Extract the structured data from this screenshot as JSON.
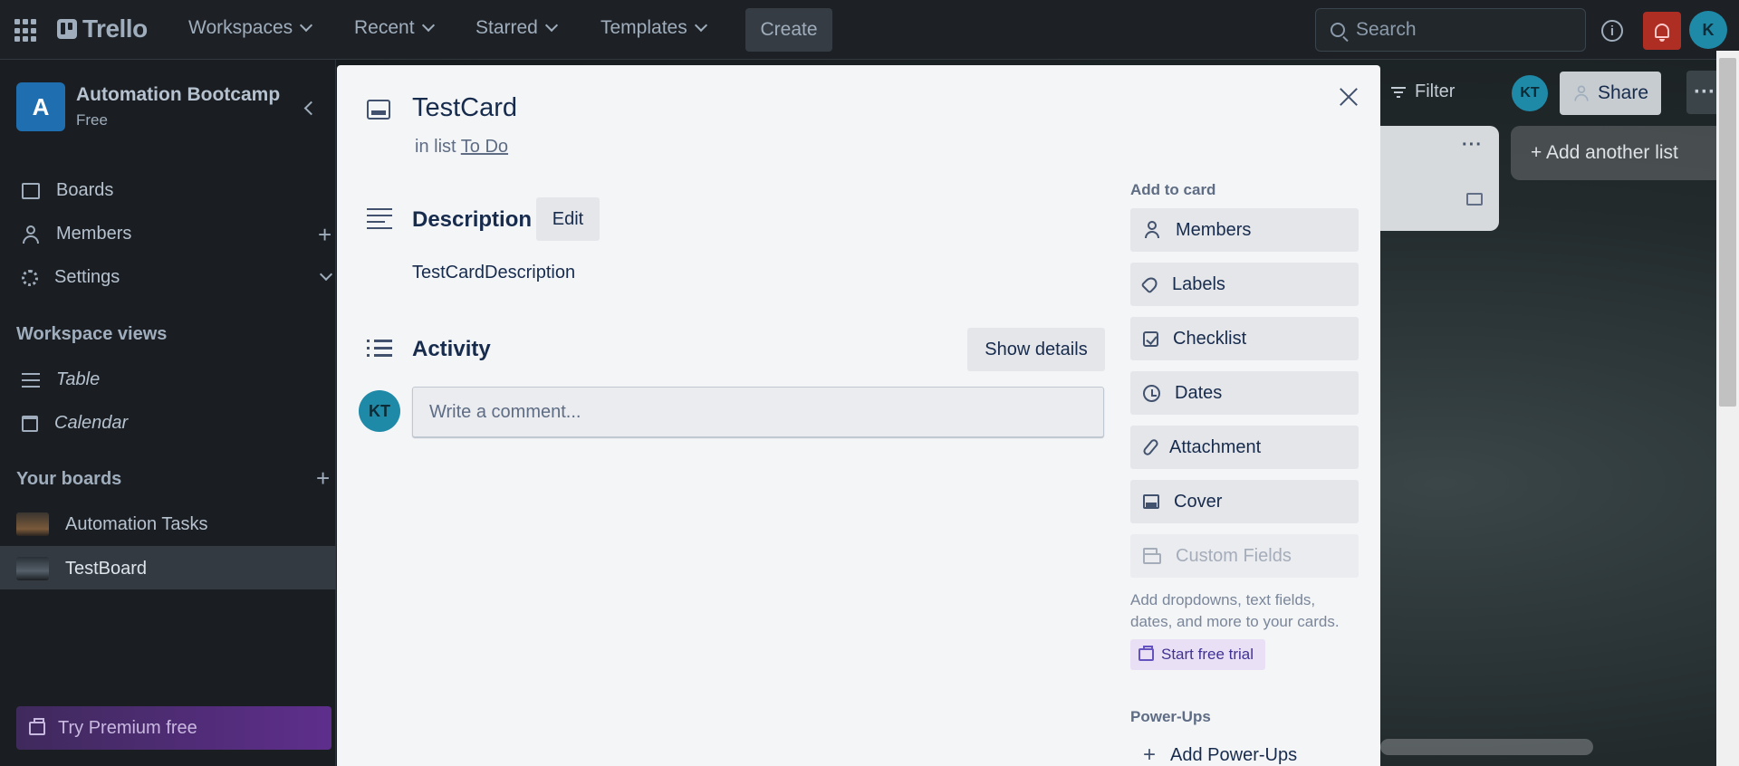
{
  "topnav": {
    "logo_text": "Trello",
    "workspaces": "Workspaces",
    "recent": "Recent",
    "starred": "Starred",
    "templates": "Templates",
    "create": "Create",
    "search_placeholder": "Search",
    "avatar_initial": "K",
    "info_label": "i"
  },
  "sidebar": {
    "workspace_initial": "A",
    "workspace_name": "Automation Bootcamp",
    "workspace_plan": "Free",
    "items": [
      {
        "label": "Boards",
        "icon": "board-icon"
      },
      {
        "label": "Members",
        "icon": "person-icon"
      },
      {
        "label": "Settings",
        "icon": "gear-icon"
      }
    ],
    "views_heading": "Workspace views",
    "views": [
      {
        "label": "Table",
        "icon": "table-icon"
      },
      {
        "label": "Calendar",
        "icon": "calendar-icon"
      }
    ],
    "boards_heading": "Your boards",
    "boards": [
      {
        "label": "Automation Tasks",
        "selected": false
      },
      {
        "label": "TestBoard",
        "selected": true
      }
    ],
    "premium": "Try Premium free"
  },
  "board_header": {
    "filter": "Filter",
    "avatar_initials": "KT",
    "share": "Share",
    "more": "···",
    "add_list": "+ Add another list",
    "list_more": "···"
  },
  "card": {
    "title": "TestCard",
    "in_list_prefix": "in list",
    "list_name": "To Do",
    "description_heading": "Description",
    "edit_label": "Edit",
    "description_text": "TestCardDescription",
    "activity_heading": "Activity",
    "show_details_label": "Show details",
    "comment_avatar": "KT",
    "comment_placeholder": "Write a comment..."
  },
  "card_sidebar": {
    "add_to_card_heading": "Add to card",
    "buttons": [
      {
        "label": "Members",
        "icon": "person-icon"
      },
      {
        "label": "Labels",
        "icon": "tag-icon"
      },
      {
        "label": "Checklist",
        "icon": "checklist-icon"
      },
      {
        "label": "Dates",
        "icon": "clock-icon"
      },
      {
        "label": "Attachment",
        "icon": "paperclip-icon"
      },
      {
        "label": "Cover",
        "icon": "cover-icon"
      },
      {
        "label": "Custom Fields",
        "icon": "custom-fields-icon",
        "disabled": true
      }
    ],
    "custom_fields_note": "Add dropdowns, text fields, dates, and more to your cards.",
    "trial_label": "Start free trial",
    "powerups_heading": "Power-Ups",
    "add_powerups": "Add Power-Ups"
  },
  "colors": {
    "nav_bg": "#1d2125",
    "modal_bg": "#f4f5f7",
    "accent_avatar": "#1f8aa8",
    "notification_red": "#ae2e24",
    "premium_purple": "#5e2e8c"
  }
}
